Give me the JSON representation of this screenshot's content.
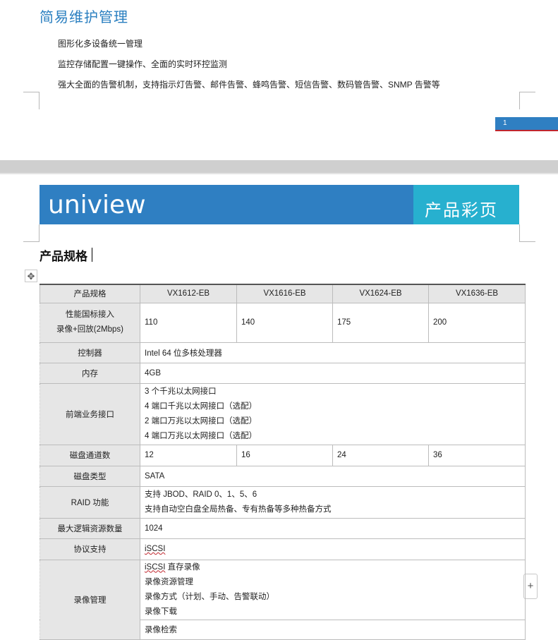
{
  "page1": {
    "heading": "简易维护管理",
    "lines": [
      "图形化多设备统一管理",
      "监控存储配置一键操作、全面的实时环控监测",
      "强大全面的告警机制，支持指示灯告警、邮件告警、蜂鸣告警、短信告警、数码管告警、SNMP 告警等"
    ],
    "page_number": "1"
  },
  "banner": {
    "brand": "uniview",
    "title": "产品彩页",
    "colors": {
      "banner": "#2f7fc2",
      "accent": "#27b0cf"
    }
  },
  "section_title": "产品规格",
  "icons": {
    "move": "move-arrows-icon",
    "add": "plus-icon"
  },
  "table": {
    "header": [
      "产品规格",
      "VX1612-EB",
      "VX1616-EB",
      "VX1624-EB",
      "VX1636-EB"
    ],
    "perf": {
      "label_line1": "性能国标接入",
      "label_line2": "录像+回放(2Mbps)",
      "values": [
        "110",
        "140",
        "175",
        "200"
      ]
    },
    "controller": {
      "label": "控制器",
      "value": "Intel 64 位多核处理器"
    },
    "memory": {
      "label": "内存",
      "value": "4GB"
    },
    "frontend": {
      "label": "前端业务接口",
      "values": [
        "3 个千兆以太网接口",
        "4 端口千兆以太网接口（选配）",
        "2 端口万兆以太网接口（选配）",
        "4 端口万兆以太网接口（选配）"
      ]
    },
    "disk_channels": {
      "label": "磁盘通道数",
      "values": [
        "12",
        "16",
        "24",
        "36"
      ]
    },
    "disk_type": {
      "label": "磁盘类型",
      "value": "SATA"
    },
    "raid": {
      "label": "RAID 功能",
      "values": [
        "支持 JBOD、RAID 0、1、5、6",
        "支持自动空白盘全局热备、专有热备等多种热备方式"
      ]
    },
    "max_logical": {
      "label": "最大逻辑资源数量",
      "value": "1024"
    },
    "protocol": {
      "label": "协议支持",
      "value": "iSCSI"
    },
    "recording": {
      "label": "录像管理",
      "values": [
        "iSCSI 直存录像",
        "录像资源管理",
        "录像方式（计划、手动、告警联动）",
        "录像下载"
      ],
      "search": "录像检索"
    }
  }
}
